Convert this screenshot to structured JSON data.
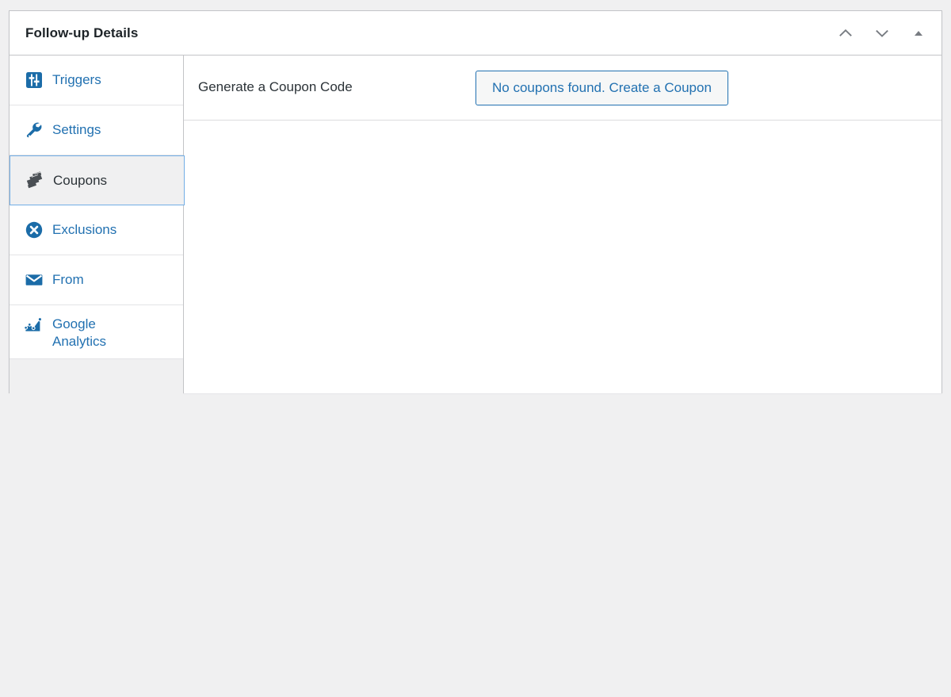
{
  "panel": {
    "title": "Follow-up Details",
    "header_controls": [
      {
        "name": "move-up-button",
        "icon": "chevron-up-icon",
        "label": "Move up"
      },
      {
        "name": "move-down-button",
        "icon": "chevron-down-icon",
        "label": "Move down"
      },
      {
        "name": "toggle-panel-button",
        "icon": "triangle-up-icon",
        "label": "Toggle panel"
      }
    ]
  },
  "sidebar": {
    "items": [
      {
        "label": "Triggers",
        "icon": "sliders-icon",
        "active": false
      },
      {
        "label": "Settings",
        "icon": "wrench-icon",
        "active": false
      },
      {
        "label": "Coupons",
        "icon": "coupons-icon",
        "active": true
      },
      {
        "label": "Exclusions",
        "icon": "circle-x-icon",
        "active": false
      },
      {
        "label": "From",
        "icon": "envelope-icon",
        "active": false
      },
      {
        "label": "Google Analytics",
        "icon": "analytics-chart-icon",
        "active": false
      }
    ]
  },
  "main": {
    "fields": [
      {
        "label": "Generate a Coupon Code",
        "button_label": "No coupons found. Create a Coupon"
      }
    ]
  },
  "colors": {
    "link": "#2271b1",
    "border": "#c3c4c7",
    "active_border": "#72aee6",
    "active_background": "#f0f0f1",
    "page_background": "#f0f0f1",
    "panel_background": "#ffffff",
    "text": "#2c3338",
    "heading": "#1d2327",
    "coupon_icon": "#50575e"
  }
}
